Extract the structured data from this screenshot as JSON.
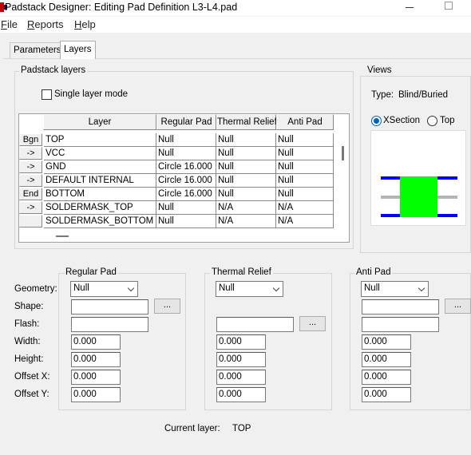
{
  "window": {
    "title": "Padstack Designer: Editing Pad Definition L3-L4.pad",
    "icon": "padstack-designer-app-icon"
  },
  "menu": [
    {
      "key": "F",
      "rest": "ile"
    },
    {
      "key": "R",
      "rest": "eports"
    },
    {
      "key": "H",
      "rest": "elp"
    }
  ],
  "tabs": [
    {
      "label": "Parameters",
      "active": false
    },
    {
      "label": "Layers",
      "active": true
    }
  ],
  "padstack_layers": {
    "title": "Padstack layers",
    "single_layer_mode": {
      "label": "Single layer mode",
      "checked": false
    },
    "columns": [
      "Layer",
      "Regular Pad",
      "Thermal Relief",
      "Anti Pad"
    ],
    "rows": [
      {
        "btn": "Bgn",
        "layer": "TOP",
        "regular": "Null",
        "thermal": "Null",
        "anti": "Null"
      },
      {
        "btn": "->",
        "layer": "VCC",
        "regular": "Null",
        "thermal": "Null",
        "anti": "Null"
      },
      {
        "btn": "->",
        "layer": "GND",
        "regular": "Circle 16.000",
        "thermal": "Null",
        "anti": "Null"
      },
      {
        "btn": "->",
        "layer": "DEFAULT INTERNAL",
        "regular": "Circle 16.000",
        "thermal": "Null",
        "anti": "Null"
      },
      {
        "btn": "End",
        "layer": "BOTTOM",
        "regular": "Circle 16.000",
        "thermal": "Null",
        "anti": "Null"
      },
      {
        "btn": "->",
        "layer": "SOLDERMASK_TOP",
        "regular": "Null",
        "thermal": "N/A",
        "anti": "N/A"
      },
      {
        "btn": "",
        "layer": "SOLDERMASK_BOTTOM",
        "regular": "Null",
        "thermal": "N/A",
        "anti": "N/A"
      }
    ]
  },
  "views": {
    "title": "Views",
    "type_label": "Type:",
    "type_value": "Blind/Buried",
    "options": [
      {
        "label": "XSection",
        "selected": true
      },
      {
        "label": "Top",
        "selected": false
      }
    ],
    "colors": {
      "pad": "#00ff00",
      "layer": "#0000ff",
      "inner_layer": "#b4b4b4"
    }
  },
  "row_labels": {
    "geometry": "Geometry:",
    "shape": "Shape:",
    "flash": "Flash:",
    "width": "Width:",
    "height": "Height:",
    "offset_x": "Offset X:",
    "offset_y": "Offset Y:"
  },
  "pad_sections": {
    "regular": {
      "title": "Regular Pad",
      "geometry": "Null",
      "shape": "",
      "flash": "",
      "width": "0.000",
      "height": "0.000",
      "offset_x": "0.000",
      "offset_y": "0.000",
      "browse_label": "..."
    },
    "thermal": {
      "title": "Thermal Relief",
      "geometry": "Null",
      "flash": "",
      "width": "0.000",
      "height": "0.000",
      "offset_x": "0.000",
      "offset_y": "0.000",
      "browse_label": "..."
    },
    "anti": {
      "title": "Anti Pad",
      "geometry": "Null",
      "shape": "",
      "flash": "",
      "width": "0.000",
      "height": "0.000",
      "offset_x": "0.000",
      "offset_y": "0.000",
      "browse_label": "..."
    }
  },
  "current_layer": {
    "label": "Current layer:",
    "value": "TOP"
  }
}
